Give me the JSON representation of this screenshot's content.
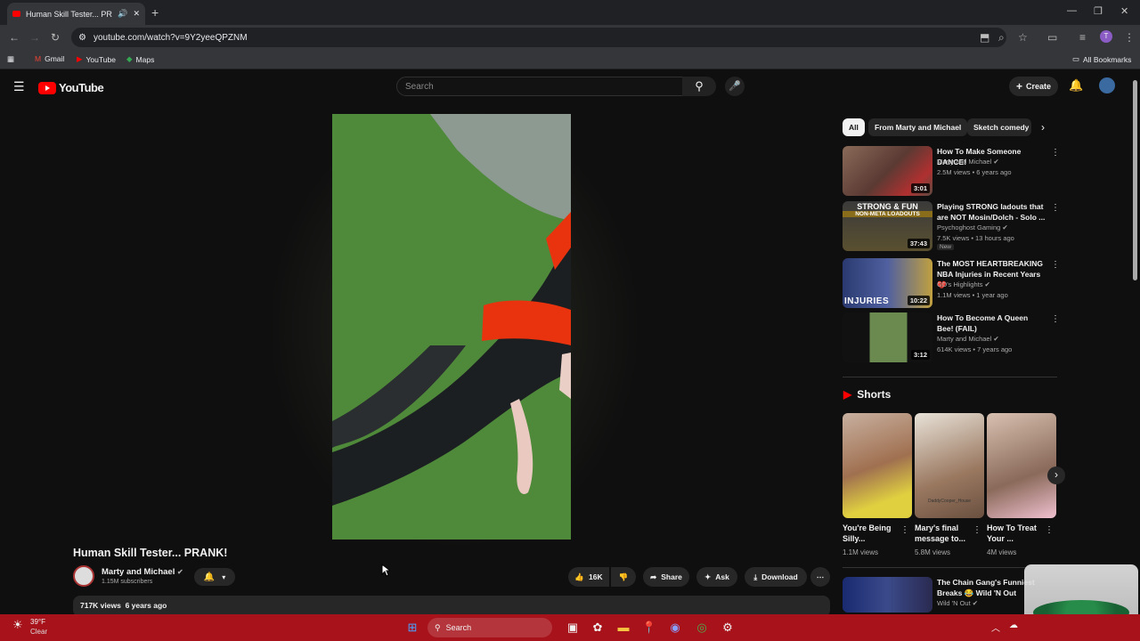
{
  "browser": {
    "tab_title": "Human Skill Tester... PRANK!",
    "url": "youtube.com/watch?v=9Y2yeeQPZNM"
  },
  "bookmarks": {
    "items": [
      "Gmail",
      "YouTube",
      "Maps"
    ],
    "all": "All Bookmarks"
  },
  "header": {
    "logo": "YouTube",
    "search_placeholder": "Search",
    "create": "Create"
  },
  "video": {
    "title": "Human Skill Tester... PRANK!",
    "channel": "Marty and Michael",
    "subscribers": "1.15M subscribers",
    "likes": "16K",
    "share": "Share",
    "ask": "Ask",
    "download": "Download",
    "views": "717K views",
    "age": "6 years ago"
  },
  "chips": [
    "All",
    "From Marty and Michael",
    "Sketch comedy"
  ],
  "recommended": [
    {
      "title": "How To Make Someone DANCE!",
      "channel": "Marty and Michael",
      "meta": "2.5M views • 6 years ago",
      "duration": "3:01"
    },
    {
      "title": "Playing STRONG ladouts that are NOT Mosin/Dolch - Solo ...",
      "channel": "Psychoghost Gaming",
      "meta": "7.5K views • 13 hours ago",
      "duration": "37:43",
      "badge": "New",
      "thumb_text": "STRONG & FUN",
      "thumb_sub": "NON-META LOADOUTS"
    },
    {
      "title": "The MOST HEARTBREAKING NBA Injuries in Recent Years 💔",
      "channel": "GD's Highlights",
      "meta": "1.1M views • 1 year ago",
      "duration": "10:22",
      "thumb_text": "INJURIES"
    },
    {
      "title": "How To Become A Queen Bee! (FAIL)",
      "channel": "Marty and Michael",
      "meta": "614K views • 7 years ago",
      "duration": "3:12"
    },
    {
      "title": "The Chain Gang's Funniest Breaks 😂 Wild 'N Out",
      "channel": "Wild 'N Out",
      "meta": "",
      "duration": ""
    }
  ],
  "shorts": {
    "heading": "Shorts",
    "items": [
      {
        "title": "You're Being Silly...",
        "views": "1.1M views"
      },
      {
        "title": "Mary's final message to...",
        "views": "5.8M views",
        "thumb_text": "DaddyCooper_House"
      },
      {
        "title": "How To Treat Your ...",
        "views": "4M views"
      }
    ]
  },
  "taskbar": {
    "temp": "39°F",
    "weather": "Clear",
    "search": "Search"
  }
}
